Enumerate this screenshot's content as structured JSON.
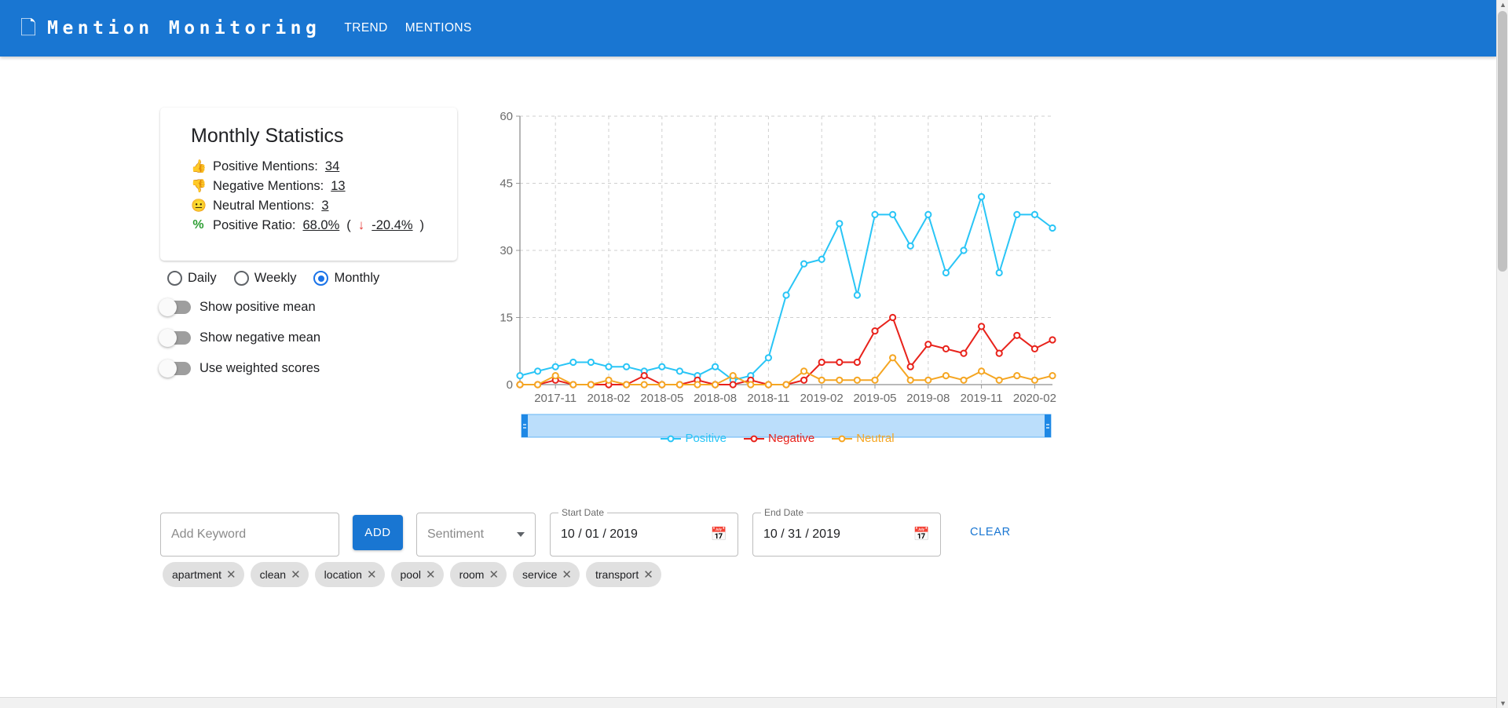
{
  "header": {
    "brand_icon": "document-scan-icon",
    "title": "Mention Monitoring",
    "nav": [
      {
        "label": "TREND"
      },
      {
        "label": "MENTIONS"
      }
    ],
    "background": "#1976d2"
  },
  "stats": {
    "title": "Monthly Statistics",
    "rows": [
      {
        "icon": "thumbs-up-icon",
        "glyph": "👍",
        "label": "Positive Mentions:",
        "value": "34"
      },
      {
        "icon": "thumbs-down-icon",
        "glyph": "👎",
        "label": "Negative Mentions:",
        "value": "13"
      },
      {
        "icon": "neutral-face-icon",
        "glyph": "😐",
        "label": "Neutral Mentions:",
        "value": "3"
      }
    ],
    "ratio": {
      "icon": "percent-icon",
      "glyph": "%",
      "label": "Positive Ratio:",
      "value": "68.0%",
      "open_paren": "(",
      "arrow": "↓",
      "delta": "-20.4%",
      "close_paren": ")"
    }
  },
  "granularity": {
    "options": [
      {
        "label": "Daily",
        "selected": false
      },
      {
        "label": "Weekly",
        "selected": false
      },
      {
        "label": "Monthly",
        "selected": true
      }
    ]
  },
  "toggles": [
    {
      "label": "Show positive mean",
      "on": false
    },
    {
      "label": "Show negative mean",
      "on": false
    },
    {
      "label": "Use weighted scores",
      "on": false
    }
  ],
  "chart_data": {
    "type": "line",
    "title": "",
    "xlabel": "",
    "ylabel": "",
    "ylim": [
      0,
      60
    ],
    "yticks": [
      0,
      15,
      30,
      45,
      60
    ],
    "grid": true,
    "legend_position": "bottom",
    "xticks": [
      "2017-11",
      "2018-02",
      "2018-05",
      "2018-08",
      "2018-11",
      "2019-02",
      "2019-05",
      "2019-08",
      "2019-11",
      "2020-02"
    ],
    "x": [
      "2017-09",
      "2017-10",
      "2017-11",
      "2017-12",
      "2018-01",
      "2018-02",
      "2018-03",
      "2018-04",
      "2018-05",
      "2018-06",
      "2018-07",
      "2018-08",
      "2018-09",
      "2018-10",
      "2018-11",
      "2018-12",
      "2019-01",
      "2019-02",
      "2019-03",
      "2019-04",
      "2019-05",
      "2019-06",
      "2019-07",
      "2019-08",
      "2019-09",
      "2019-10",
      "2019-11",
      "2019-12",
      "2020-01",
      "2020-02",
      "2020-03"
    ],
    "series": [
      {
        "name": "Positive",
        "color": "#29c5f6",
        "values": [
          2,
          3,
          4,
          5,
          5,
          4,
          4,
          3,
          4,
          3,
          2,
          4,
          1,
          2,
          6,
          20,
          27,
          28,
          36,
          20,
          38,
          38,
          31,
          38,
          25,
          30,
          42,
          25,
          38,
          38,
          35,
          34
        ]
      },
      {
        "name": "Negative",
        "color": "#e8221b",
        "values": [
          0,
          0,
          1,
          0,
          0,
          0,
          0,
          2,
          0,
          0,
          1,
          0,
          0,
          1,
          0,
          0,
          1,
          5,
          5,
          5,
          12,
          15,
          4,
          9,
          8,
          7,
          13,
          7,
          11,
          8,
          10,
          13
        ]
      },
      {
        "name": "Neutral",
        "color": "#f5a623",
        "values": [
          0,
          0,
          2,
          0,
          0,
          1,
          0,
          0,
          0,
          0,
          0,
          0,
          2,
          0,
          0,
          0,
          3,
          1,
          1,
          1,
          1,
          6,
          1,
          1,
          2,
          1,
          3,
          1,
          2,
          1,
          2,
          2
        ]
      }
    ],
    "legend": [
      {
        "label": "Positive",
        "color": "#29c5f6"
      },
      {
        "label": "Negative",
        "color": "#e8221b"
      },
      {
        "label": "Neutral",
        "color": "#f5a623"
      }
    ],
    "brush": {
      "name": "range-slider",
      "fill": "#bbdefb",
      "handle": "#1e88e5"
    }
  },
  "form": {
    "keyword_placeholder": "Add Keyword",
    "keyword_value": "",
    "add_label": "ADD",
    "sentiment_placeholder": "Sentiment",
    "start_date": {
      "label": "Start Date",
      "value": "10 / 01 / 2019"
    },
    "end_date": {
      "label": "End Date",
      "value": "10 / 31 / 2019"
    },
    "clear_label": "CLEAR"
  },
  "chips": [
    {
      "label": "apartment"
    },
    {
      "label": "clean"
    },
    {
      "label": "location"
    },
    {
      "label": "pool"
    },
    {
      "label": "room"
    },
    {
      "label": "service"
    },
    {
      "label": "transport"
    }
  ]
}
